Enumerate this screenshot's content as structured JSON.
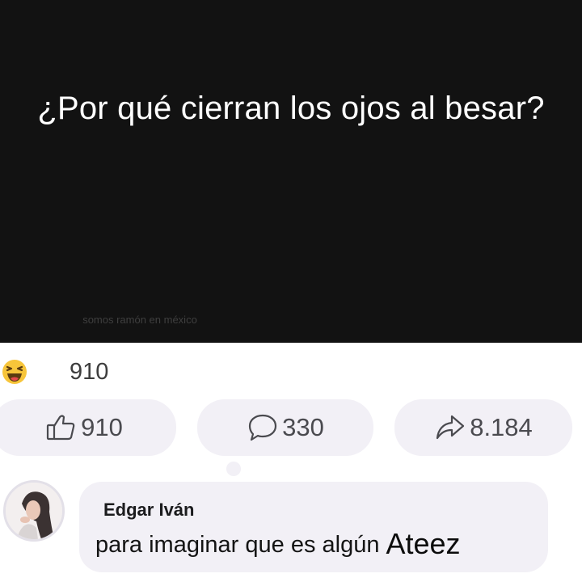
{
  "post": {
    "question": "¿Por qué cierran los ojos al besar?",
    "watermark": "somos ramón en méxico"
  },
  "reactions": {
    "icon": "haha-emoji-icon",
    "count": "910"
  },
  "actions": {
    "like": {
      "icon": "thumbs-up-icon",
      "count": "910"
    },
    "comment": {
      "icon": "comment-bubble-icon",
      "count": "330"
    },
    "share": {
      "icon": "share-arrow-icon",
      "count": "8.184"
    }
  },
  "comment": {
    "author": "Edgar Iván",
    "text": "para imaginar que es algún",
    "highlight": "Ateez"
  },
  "colors": {
    "post_background": "#121212",
    "pill_background": "#f2f0f6",
    "haha_yellow": "#f7c53a"
  }
}
